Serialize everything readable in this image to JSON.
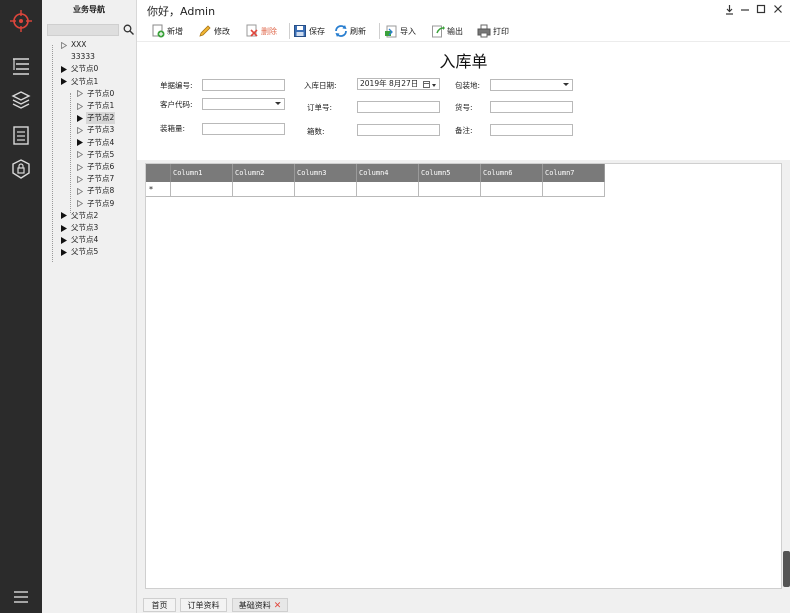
{
  "greeting": "你好，Admin",
  "nav": {
    "title": "业务导航",
    "tree": [
      {
        "label": "XXX",
        "level": 1,
        "expander": "collapsed"
      },
      {
        "label": "33333",
        "level": 1,
        "expander": "none"
      },
      {
        "label": "父节点0",
        "level": 1,
        "expander": "filled"
      },
      {
        "label": "父节点1",
        "level": 1,
        "expander": "filled"
      },
      {
        "label": "子节点0",
        "level": 2,
        "expander": "collapsed"
      },
      {
        "label": "子节点1",
        "level": 2,
        "expander": "collapsed"
      },
      {
        "label": "子节点2",
        "level": 2,
        "expander": "filled",
        "selected": true
      },
      {
        "label": "子节点3",
        "level": 2,
        "expander": "collapsed"
      },
      {
        "label": "子节点4",
        "level": 2,
        "expander": "filled"
      },
      {
        "label": "子节点5",
        "level": 2,
        "expander": "collapsed"
      },
      {
        "label": "子节点6",
        "level": 2,
        "expander": "collapsed"
      },
      {
        "label": "子节点7",
        "level": 2,
        "expander": "collapsed"
      },
      {
        "label": "子节点8",
        "level": 2,
        "expander": "collapsed"
      },
      {
        "label": "子节点9",
        "level": 2,
        "expander": "collapsed"
      },
      {
        "label": "父节点2",
        "level": 1,
        "expander": "filled"
      },
      {
        "label": "父节点3",
        "level": 1,
        "expander": "filled"
      },
      {
        "label": "父节点4",
        "level": 1,
        "expander": "filled"
      },
      {
        "label": "父节点5",
        "level": 1,
        "expander": "filled"
      }
    ]
  },
  "toolbar": {
    "new": "新增",
    "edit": "修改",
    "delete": "删除",
    "save": "保存",
    "refresh": "刷新",
    "import": "导入",
    "export": "输出",
    "print": "打印"
  },
  "form": {
    "title": "入库单",
    "doc_no_label": "单据编号:",
    "doc_no_value": "",
    "inbound_date_label": "入库日期:",
    "inbound_date_value": "2019年  8月27日",
    "pack_place_label": "包装地:",
    "pack_place_value": "",
    "customer_code_label": "客户代码:",
    "customer_code_value": "",
    "order_no_label": "订单号:",
    "order_no_value": "",
    "goods_no_label": "货号:",
    "goods_no_value": "",
    "box_qty_label": "装箱量:",
    "box_qty_value": "",
    "box_count_label": "箱数:",
    "box_count_value": "",
    "remark_label": "备注:",
    "remark_value": ""
  },
  "grid": {
    "columns": [
      "Column1",
      "Column2",
      "Column3",
      "Column4",
      "Column5",
      "Column6",
      "Column7"
    ],
    "new_row_marker": "*"
  },
  "tabs": {
    "home": "首页",
    "order": "订单资料",
    "basic": "基础资料",
    "close": "✕"
  },
  "colors": {
    "rail": "#2b2b2b",
    "logo": "#e0463c",
    "grid_header": "#7a7a7a",
    "delete_text": "#e06a4e"
  }
}
